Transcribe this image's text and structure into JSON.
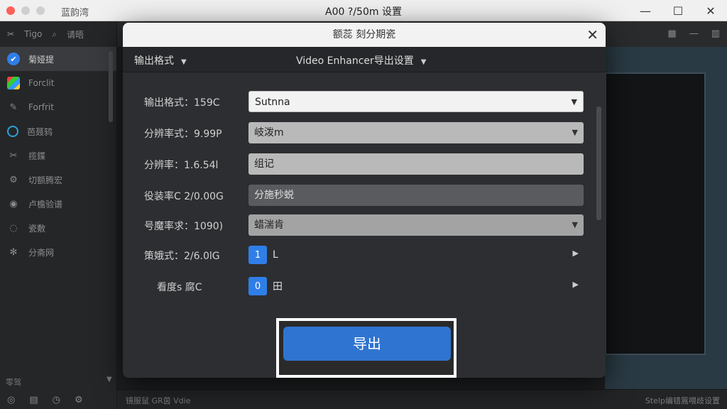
{
  "window": {
    "app_name": "蓝韵湾",
    "title": "A00 ?/50m 设置",
    "controls": {
      "minimize": "—",
      "maximize": "☐",
      "close": "✕"
    }
  },
  "sidebar": {
    "top_label": "Tigo",
    "top_label2": "请晤",
    "items": [
      {
        "label": "菊娅提",
        "icon": "check-icon",
        "active": true
      },
      {
        "label": "Forclit",
        "icon": "grid-icon",
        "active": false
      },
      {
        "label": "Forfrit",
        "icon": "brush-icon",
        "active": false
      },
      {
        "label": "芭聂鸫",
        "icon": "ring-icon",
        "active": false
      },
      {
        "label": "揽鍱",
        "icon": "scissors-icon",
        "active": false
      },
      {
        "label": "切额腾宏",
        "icon": "gear-icon",
        "active": false
      },
      {
        "label": "卢檐验谱",
        "icon": "paint-icon",
        "active": false
      },
      {
        "label": "瓷敷",
        "icon": "chat-icon",
        "active": false
      },
      {
        "label": "分斋网",
        "icon": "cog-icon",
        "active": false
      }
    ],
    "footer_label": "零驾"
  },
  "statusbar": {
    "left": "镜服鼠 GR茵 Vdie",
    "right": "Stelp编错篙喂歧设置"
  },
  "dialog": {
    "title": "额蕊 刻分期瓷",
    "close": "✕",
    "tab_left": "输出格式",
    "tab_center": "Video Enhancer导出设置",
    "rows": [
      {
        "label": "输出格式：159C",
        "value": "Sutnna",
        "dropdown": true,
        "style": "light"
      },
      {
        "label": "分辨率式：9.99P",
        "value": "岐泼m",
        "dropdown": true,
        "style": "gray"
      },
      {
        "label": "分辨率：1.6.54l",
        "value": "组记",
        "dropdown": false,
        "style": "gray"
      },
      {
        "label": "役装率C 2/0.00G",
        "value": "分施秒蜕",
        "dropdown": false,
        "style": "dark"
      },
      {
        "label": "号魔率求：1090)",
        "value": "蜡湍肯",
        "dropdown": true,
        "style": "gray2"
      }
    ],
    "steppers": [
      {
        "label": "策娥式：2/6.0lG",
        "value": "1",
        "unit": "L"
      },
      {
        "label": "看度s 腐C",
        "value": "0",
        "unit": "田"
      }
    ],
    "export_label": "导出"
  }
}
